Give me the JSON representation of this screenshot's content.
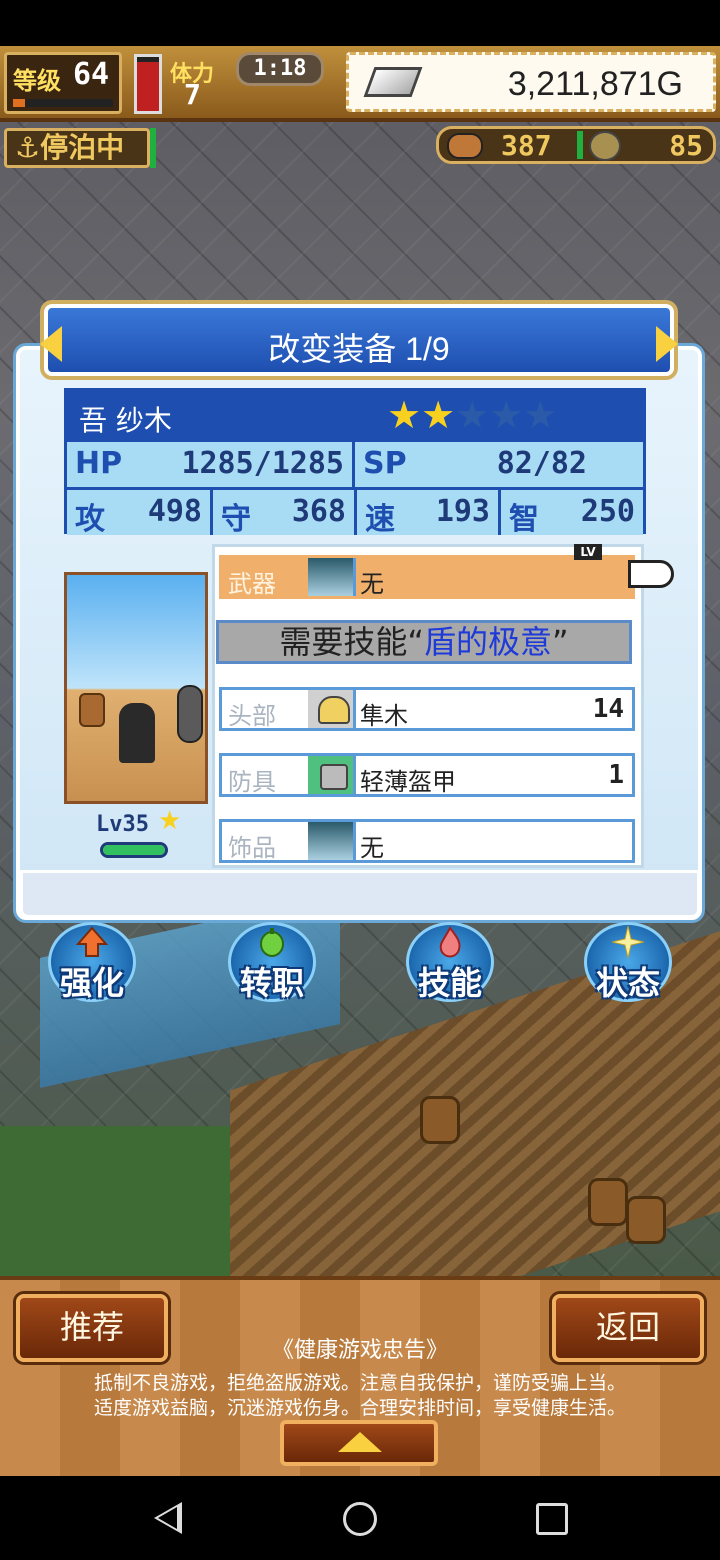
{
  "hud": {
    "level_label": "等级",
    "level": "64",
    "exp_progress": 0.12,
    "stamina_label": "体力",
    "stamina": "7",
    "stamina_gauge": 0.9,
    "time": "1:18",
    "gold": "3,211,871G",
    "dock_status": "停泊中",
    "food": "387",
    "medals": "85"
  },
  "panel": {
    "title": "改变装备 1/9",
    "character": {
      "name": "吾 纱木",
      "stars_filled": 2,
      "stars_total": 5,
      "hp_label": "HP",
      "hp": "1285/1285",
      "sp_label": "SP",
      "sp": "82/82",
      "atk_label": "攻",
      "atk": "498",
      "def_label": "守",
      "def": "368",
      "spd_label": "速",
      "spd": "193",
      "int_label": "智",
      "int": "250",
      "level_text": "Lv35",
      "hp_bar": 1.0
    },
    "lv_tag": "LV",
    "skill_prefix": "需要技能“",
    "skill_name": "盾的极意",
    "skill_suffix": "”",
    "equipment": [
      {
        "slot": "武器",
        "item": "无",
        "lv": "",
        "icon": "empty-slot-icon"
      },
      {
        "slot": "头部",
        "item": "隼木",
        "lv": "14",
        "icon": "helmet-icon"
      },
      {
        "slot": "防具",
        "item": "轻薄盔甲",
        "lv": "1",
        "icon": "armor-icon"
      },
      {
        "slot": "饰品",
        "item": "无",
        "lv": "",
        "icon": "empty-slot-icon"
      }
    ]
  },
  "menu": [
    {
      "label": "强化",
      "icon": "up-arrow-icon",
      "color": "#f07030"
    },
    {
      "label": "转职",
      "icon": "pepper-icon",
      "color": "#70d040"
    },
    {
      "label": "技能",
      "icon": "flame-icon",
      "color": "#f08080"
    },
    {
      "label": "状态",
      "icon": "sparkle-icon",
      "color": "#f8f0a0"
    }
  ],
  "bottom": {
    "recommend": "推荐",
    "back": "返回",
    "health_title": "《健康游戏忠告》",
    "health_line1": "抵制不良游戏，拒绝盗版游戏。注意自我保护，谨防受骗上当。",
    "health_line2": "适度游戏益脑，沉迷游戏伤身。合理安排时间，享受健康生活。"
  },
  "colors": {
    "panel_blue": "#1e4fb0",
    "selected_row": "#f0b06c",
    "skill_highlight": "#1e3ad8",
    "star": "#f8d020"
  }
}
